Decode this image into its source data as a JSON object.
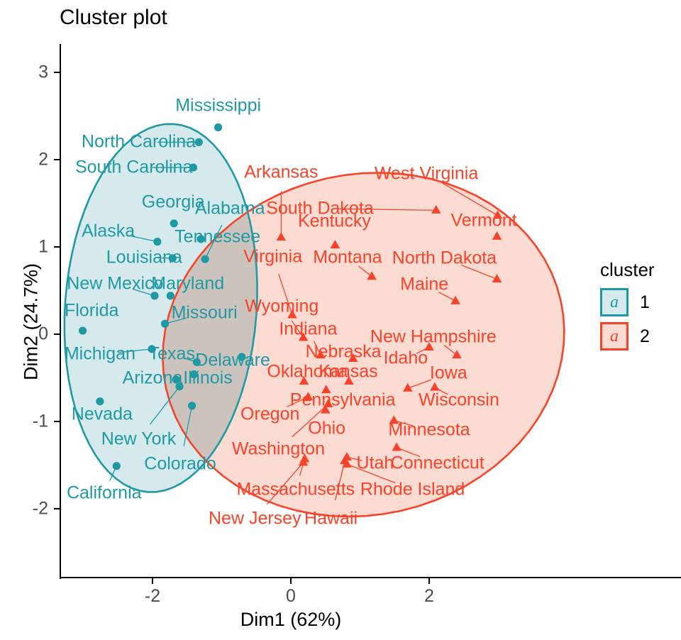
{
  "title": "Cluster plot",
  "axes": {
    "x": {
      "title": "Dim1 (62%)",
      "ticks": [
        "-2",
        "0",
        "2"
      ],
      "tick_values": [
        -2,
        0,
        2
      ],
      "range": [
        -3.4,
        3.6
      ]
    },
    "y": {
      "title": "Dim2 (24.7%)",
      "ticks": [
        "3",
        "2",
        "1",
        "0",
        "-1",
        "-2"
      ],
      "tick_values": [
        3,
        2,
        1,
        0,
        -1,
        -2
      ],
      "range": [
        -2.55,
        3.2
      ]
    }
  },
  "legend": {
    "title": "cluster",
    "glyph": "a",
    "items": [
      {
        "label": "1",
        "fill": "#d6e9ec",
        "stroke": "#1f9aa5"
      },
      {
        "label": "2",
        "fill": "#fbdbd2",
        "stroke": "#f8432a"
      }
    ]
  },
  "colors": {
    "cluster1_point": "#1f9aa5",
    "cluster1_fill": "#d6e9ec",
    "cluster2_point": "#f8432a",
    "cluster2_fill": "#fbdbd2",
    "overlap_fill": "#cdc3bd",
    "axis": "#000000",
    "tick_label": "#4d4d4d"
  },
  "chart_data": {
    "type": "scatter",
    "title": "Cluster plot",
    "xlabel": "Dim1 (62%)",
    "ylabel": "Dim2 (24.7%)",
    "xlim": [
      -3.4,
      3.6
    ],
    "ylim": [
      -2.55,
      3.2
    ],
    "grid": false,
    "legend_position": "right",
    "legend_title": "cluster",
    "series": [
      {
        "name": "1",
        "marker": "circle",
        "color": "#1f9aa5",
        "points": [
          {
            "label": "Mississippi",
            "x": -1.05,
            "y": 2.37,
            "lx": -1.05,
            "ly": 2.62
          },
          {
            "label": "North Carolina",
            "x": -1.33,
            "y": 2.2,
            "lx": -2.2,
            "ly": 2.2
          },
          {
            "label": "South Carolina",
            "x": -1.41,
            "y": 1.91,
            "lx": -2.27,
            "ly": 1.91
          },
          {
            "label": "Georgia",
            "x": -1.69,
            "y": 1.27,
            "lx": -1.7,
            "ly": 1.51
          },
          {
            "label": "Alaska",
            "x": -1.93,
            "y": 1.06,
            "lx": -2.64,
            "ly": 1.18
          },
          {
            "label": "Alabama",
            "x": -1.24,
            "y": 0.86,
            "lx": -0.88,
            "ly": 1.44
          },
          {
            "label": "Tennessee",
            "x": -1.3,
            "y": 1.09,
            "lx": -1.06,
            "ly": 1.11
          },
          {
            "label": "Louisiana",
            "x": -1.71,
            "y": 0.87,
            "lx": -2.12,
            "ly": 0.88
          },
          {
            "label": "New Mexico",
            "x": -1.97,
            "y": 0.44,
            "lx": -2.54,
            "ly": 0.58
          },
          {
            "label": "Maryland",
            "x": -1.74,
            "y": 0.44,
            "lx": -1.49,
            "ly": 0.58
          },
          {
            "label": "Florida",
            "x": -3.01,
            "y": 0.04,
            "lx": -2.88,
            "ly": 0.27
          },
          {
            "label": "Missouri",
            "x": -1.82,
            "y": 0.12,
            "lx": -1.25,
            "ly": 0.24
          },
          {
            "label": "Michigan",
            "x": -2.01,
            "y": -0.17,
            "lx": -2.76,
            "ly": -0.23
          },
          {
            "label": "Texas",
            "x": -1.36,
            "y": -0.32,
            "lx": -1.72,
            "ly": -0.23
          },
          {
            "label": "Illinois",
            "x": -1.4,
            "y": -0.46,
            "lx": -1.2,
            "ly": -0.5
          },
          {
            "label": "Arizona",
            "x": -1.66,
            "y": -0.52,
            "lx": -2.0,
            "ly": -0.5
          },
          {
            "label": "Nevada",
            "x": -2.76,
            "y": -0.77,
            "lx": -2.73,
            "ly": -0.92
          },
          {
            "label": "New York",
            "x": -1.61,
            "y": -0.6,
            "lx": -2.2,
            "ly": -1.2
          },
          {
            "label": "Colorado",
            "x": -1.43,
            "y": -0.82,
            "lx": -1.6,
            "ly": -1.49
          },
          {
            "label": "California",
            "x": -2.52,
            "y": -1.51,
            "lx": -2.7,
            "ly": -1.82
          },
          {
            "label": "Delaware",
            "x": -0.71,
            "y": -0.26,
            "lx": -0.84,
            "ly": -0.3
          }
        ]
      },
      {
        "name": "2",
        "marker": "triangle",
        "color": "#f8432a",
        "points": [
          {
            "label": "Arkansas",
            "x": -0.14,
            "y": 1.11,
            "lx": -0.14,
            "ly": 1.85
          },
          {
            "label": "South Dakota",
            "x": 2.1,
            "y": 1.42,
            "lx": 0.42,
            "ly": 1.44
          },
          {
            "label": "West Virginia",
            "x": 2.99,
            "y": 1.36,
            "lx": 1.96,
            "ly": 1.84
          },
          {
            "label": "Vermont",
            "x": 2.98,
            "y": 1.12,
            "lx": 2.79,
            "ly": 1.3
          },
          {
            "label": "Kentucky",
            "x": 0.64,
            "y": 1.02,
            "lx": 0.63,
            "ly": 1.29
          },
          {
            "label": "North Dakota",
            "x": 2.98,
            "y": 0.63,
            "lx": 2.22,
            "ly": 0.87
          },
          {
            "label": "Virginia",
            "x": 0.02,
            "y": 0.22,
            "lx": -0.26,
            "ly": 0.89
          },
          {
            "label": "Montana",
            "x": 1.17,
            "y": 0.66,
            "lx": 0.82,
            "ly": 0.88
          },
          {
            "label": "Maine",
            "x": 2.38,
            "y": 0.38,
            "lx": 1.93,
            "ly": 0.57
          },
          {
            "label": "Wyoming",
            "x": 0.18,
            "y": -0.04,
            "lx": -0.13,
            "ly": 0.32
          },
          {
            "label": "Indiana",
            "x": 0.43,
            "y": -0.24,
            "lx": 0.25,
            "ly": 0.06
          },
          {
            "label": "New Hampshire",
            "x": 2.4,
            "y": -0.24,
            "lx": 2.06,
            "ly": -0.03
          },
          {
            "label": "Nebraska",
            "x": 0.9,
            "y": -0.28,
            "lx": 0.76,
            "ly": -0.2
          },
          {
            "label": "Idaho",
            "x": 2.0,
            "y": -0.15,
            "lx": 1.66,
            "ly": -0.28
          },
          {
            "label": "Oklahoma",
            "x": 0.19,
            "y": -0.54,
            "lx": 0.24,
            "ly": -0.43
          },
          {
            "label": "Kansas",
            "x": 0.84,
            "y": -0.54,
            "lx": 0.83,
            "ly": -0.43
          },
          {
            "label": "Iowa",
            "x": 1.69,
            "y": -0.62,
            "lx": 2.28,
            "ly": -0.45
          },
          {
            "label": "Pennsylvania",
            "x": 0.51,
            "y": -0.64,
            "lx": 0.75,
            "ly": -0.76
          },
          {
            "label": "Wisconsin",
            "x": 2.08,
            "y": -0.61,
            "lx": 2.43,
            "ly": -0.76
          },
          {
            "label": "Oregon",
            "x": 0.25,
            "y": -0.72,
            "lx": -0.3,
            "ly": -0.92
          },
          {
            "label": "Minnesota",
            "x": 1.49,
            "y": -0.99,
            "lx": 2.0,
            "ly": -1.1
          },
          {
            "label": "Ohio",
            "x": 0.5,
            "y": -0.87,
            "lx": 0.52,
            "ly": -1.08
          },
          {
            "label": "Washington",
            "x": 0.54,
            "y": -0.8,
            "lx": -0.18,
            "ly": -1.32
          },
          {
            "label": "Utah",
            "x": 0.81,
            "y": -1.41,
            "lx": 1.22,
            "ly": -1.48
          },
          {
            "label": "Connecticut",
            "x": 1.53,
            "y": -1.3,
            "lx": 2.12,
            "ly": -1.48
          },
          {
            "label": "Massachusetts",
            "x": 0.2,
            "y": -1.43,
            "lx": 0.07,
            "ly": -1.78
          },
          {
            "label": "Rhode Island",
            "x": 0.81,
            "y": -1.49,
            "lx": 1.76,
            "ly": -1.78
          },
          {
            "label": "Hawaii",
            "x": 0.78,
            "y": -1.45,
            "lx": 0.58,
            "ly": -2.11
          },
          {
            "label": "New Jersey",
            "x": 0.18,
            "y": -1.47,
            "lx": -0.52,
            "ly": -2.11
          }
        ]
      }
    ]
  }
}
